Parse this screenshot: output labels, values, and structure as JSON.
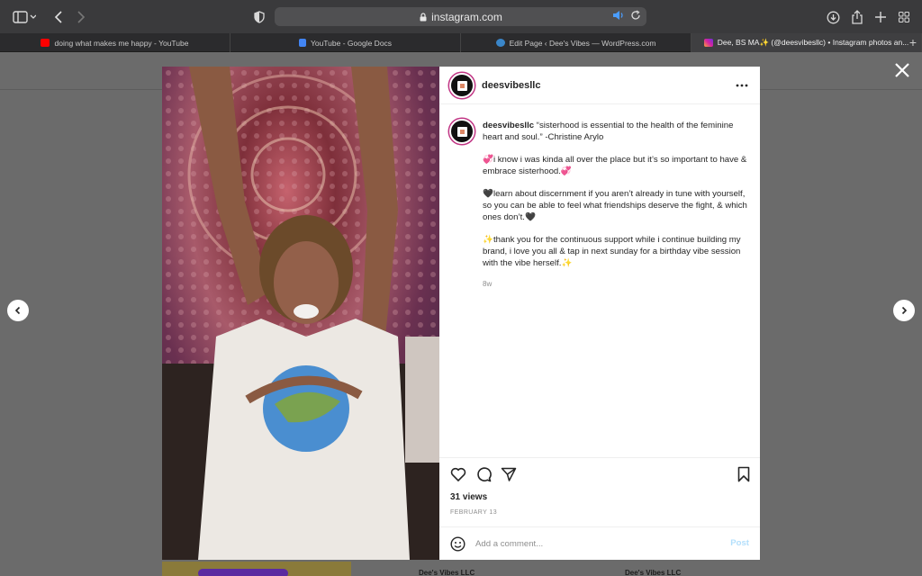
{
  "browser": {
    "url": "instagram.com",
    "tabs": [
      {
        "label": "doing what makes me happy - YouTube",
        "color": "#ff0000"
      },
      {
        "label": "YouTube - Google Docs",
        "color": "#4285f4"
      },
      {
        "label": "Edit Page ‹ Dee's Vibes — WordPress.com",
        "color": "#3a86c9"
      },
      {
        "label": "Dee, BS MA✨ (@deesvibesllc) • Instagram photos an...",
        "color": "#d6249f"
      }
    ],
    "active_tab": 3
  },
  "post": {
    "username": "deesvibesllc",
    "caption_user": "deesvibesllc",
    "caption_lines": [
      "“sisterhood is essential to the health of the feminine heart and soul.” -Christine Arylo",
      "💞i know i was kinda all over the place but it’s so important to have & embrace sisterhood.💞",
      "🖤learn about discernment if you aren’t already in tune with yourself, so you can be able to feel what friendships deserve the fight, & which ones don’t.🖤",
      "✨thank you for the continuous support while i continue building my brand, i love you all & tap in next sunday for a birthday vibe session with the vibe herself.✨"
    ],
    "age": "8w",
    "views": "31 views",
    "date": "FEBRUARY 13",
    "comment_placeholder": "Add a comment...",
    "post_label": "Post"
  },
  "background": {
    "suggested_1": "Dee's Vibes LLC",
    "suggested_2": "Dee's Vibes LLC"
  },
  "icons": [
    "sidebar-icon",
    "back-icon",
    "forward-icon",
    "shield-icon",
    "lock-icon",
    "speaker-icon",
    "reload-icon",
    "download-icon",
    "share-icon",
    "new-tab-icon",
    "tab-overview-icon",
    "close-icon",
    "prev-arrow-icon",
    "next-arrow-icon",
    "more-icon",
    "heart-icon",
    "comment-icon",
    "share-send-icon",
    "bookmark-icon",
    "emoji-icon"
  ]
}
